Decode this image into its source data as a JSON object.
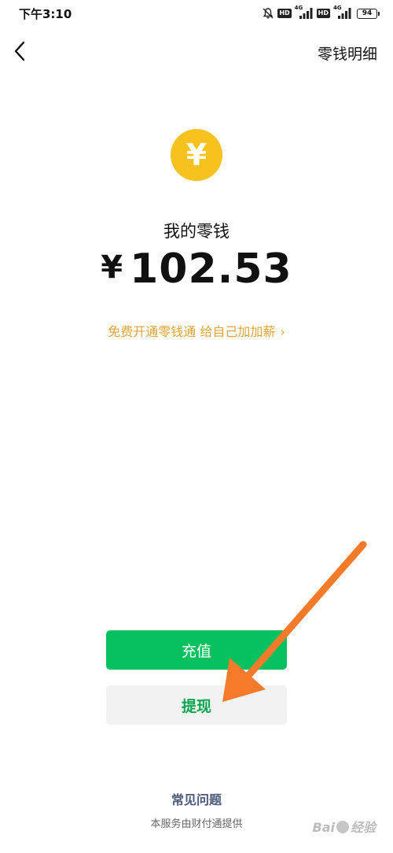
{
  "status_bar": {
    "time": "下午3:10",
    "hd_label": "HD",
    "network_label": "4G",
    "battery": "94"
  },
  "header": {
    "back_icon": "chevron-left-icon",
    "detail_link": "零钱明细"
  },
  "balance": {
    "coin_symbol": "¥",
    "label": "我的零钱",
    "currency": "¥",
    "amount": "102.53"
  },
  "promo": {
    "text": "免费开通零钱通 给自己加加薪",
    "chevron": "›"
  },
  "actions": {
    "recharge_label": "充值",
    "withdraw_label": "提现"
  },
  "footer": {
    "faq_label": "常见问题",
    "provider_note": "本服务由财付通提供"
  },
  "watermark": {
    "text_left": "Bai",
    "text_right": "经验"
  },
  "colors": {
    "green": "#07c160",
    "coin_yellow": "#f7c21e",
    "promo_orange": "#e0a43a",
    "annotation_arrow": "#f57b2a"
  }
}
